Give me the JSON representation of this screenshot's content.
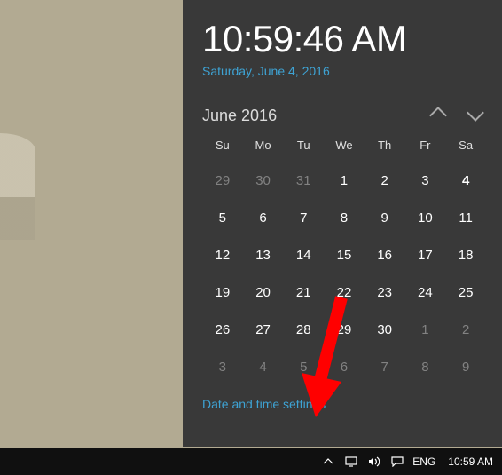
{
  "clock": {
    "time": "10:59:46 AM",
    "date_long": "Saturday, June 4, 2016"
  },
  "calendar": {
    "month_label": "June 2016",
    "weekday_headers": [
      "Su",
      "Mo",
      "Tu",
      "We",
      "Th",
      "Fr",
      "Sa"
    ],
    "weeks": [
      [
        {
          "d": 29,
          "other": true
        },
        {
          "d": 30,
          "other": true
        },
        {
          "d": 31,
          "other": true
        },
        {
          "d": 1
        },
        {
          "d": 2
        },
        {
          "d": 3
        },
        {
          "d": 4,
          "today": true
        }
      ],
      [
        {
          "d": 5
        },
        {
          "d": 6
        },
        {
          "d": 7
        },
        {
          "d": 8
        },
        {
          "d": 9
        },
        {
          "d": 10
        },
        {
          "d": 11
        }
      ],
      [
        {
          "d": 12
        },
        {
          "d": 13
        },
        {
          "d": 14
        },
        {
          "d": 15
        },
        {
          "d": 16
        },
        {
          "d": 17
        },
        {
          "d": 18
        }
      ],
      [
        {
          "d": 19
        },
        {
          "d": 20
        },
        {
          "d": 21
        },
        {
          "d": 22
        },
        {
          "d": 23
        },
        {
          "d": 24
        },
        {
          "d": 25
        }
      ],
      [
        {
          "d": 26
        },
        {
          "d": 27
        },
        {
          "d": 28
        },
        {
          "d": 29
        },
        {
          "d": 30
        },
        {
          "d": 1,
          "other": true
        },
        {
          "d": 2,
          "other": true
        }
      ],
      [
        {
          "d": 3,
          "other": true
        },
        {
          "d": 4,
          "other": true
        },
        {
          "d": 5,
          "other": true
        },
        {
          "d": 6,
          "other": true
        },
        {
          "d": 7,
          "other": true
        },
        {
          "d": 8,
          "other": true
        },
        {
          "d": 9,
          "other": true
        }
      ]
    ]
  },
  "links": {
    "settings": "Date and time settings"
  },
  "taskbar": {
    "language": "ENG",
    "clock": "10:59 AM"
  }
}
